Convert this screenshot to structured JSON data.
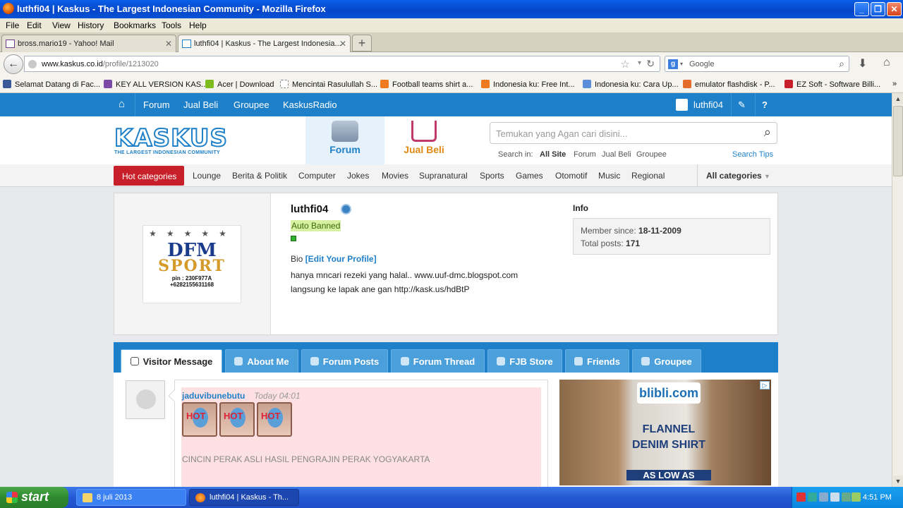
{
  "window": {
    "title": "luthfi04 | Kaskus - The Largest Indonesian Community - Mozilla Firefox"
  },
  "menu": [
    "File",
    "Edit",
    "View",
    "History",
    "Bookmarks",
    "Tools",
    "Help"
  ],
  "tabs": [
    {
      "label": "bross.mario19 - Yahoo! Mail",
      "active": false
    },
    {
      "label": "luthfi04 | Kaskus - The Largest Indonesia...",
      "active": true
    }
  ],
  "address": {
    "host": "www.kaskus.co.id",
    "path": "/profile/1213020"
  },
  "browser_search": {
    "engine_icon": "google-icon",
    "placeholder": "Google"
  },
  "bookmarks": [
    "Selamat Datang di Fac...",
    "KEY ALL VERSION KAS...",
    "Acer | Download",
    "Mencintai Rasulullah S...",
    "Football teams shirt a...",
    "Indonesia ku: Free Int...",
    "Indonesia ku: Cara Up...",
    "emulator flashdisk - P...",
    "EZ Soft - Software Billi..."
  ],
  "kaskus_nav": {
    "links": [
      "Forum",
      "Jual Beli",
      "Groupee",
      "KaskusRadio"
    ],
    "user": "luthfi04"
  },
  "header": {
    "logo": "KASKUS",
    "logo_sub": "THE LARGEST INDONESIAN COMMUNITY",
    "forum_label": "Forum",
    "jualbeli_label": "Jual Beli",
    "search_placeholder": "Temukan yang Agan cari disini...",
    "search_in_label": "Search in:",
    "search_in_options": [
      "All Site",
      "Forum",
      "Jual Beli",
      "Groupee"
    ],
    "search_tips": "Search Tips"
  },
  "categories": {
    "hot": "Hot categories",
    "items": [
      "Lounge",
      "Berita & Politik",
      "Computer",
      "Jokes",
      "Movies",
      "Supranatural",
      "Sports",
      "Games",
      "Otomotif",
      "Music",
      "Regional"
    ],
    "all": "All categories"
  },
  "profile": {
    "avatar_text": {
      "line1": "DFM",
      "line2": "SPORT",
      "pin": "pin : 230F977A",
      "phone": "+6282155631168"
    },
    "username": "luthfi04",
    "status": "Auto Banned",
    "bio_label": "Bio",
    "edit_link": "[Edit Your Profile]",
    "bio_line1": "hanya mncari rezeki yang halal.. www.uuf-dmc.blogspot.com",
    "bio_line2": "langsung ke lapak ane gan http://kask.us/hdBtP",
    "info_title": "Info",
    "member_since_label": "Member since:",
    "member_since": "18-11-2009",
    "total_posts_label": "Total posts:",
    "total_posts": "171"
  },
  "profile_tabs": [
    "Visitor Message",
    "About Me",
    "Forum Posts",
    "Forum Thread",
    "FJB Store",
    "Friends",
    "Groupee"
  ],
  "visitor_message": {
    "author": "jaduvibunebutu",
    "time": "Today 04:01",
    "badge_text": "HOT",
    "text": "CINCIN PERAK ASLI HASIL PENGRAJIN PERAK YOGYAKARTA"
  },
  "ad": {
    "brand": "blibli.com",
    "line1": "FLANNEL",
    "line2": "DENIM SHIRT",
    "line3": "AS LOW AS"
  },
  "taskbar": {
    "start": "start",
    "items": [
      "8 juli 2013",
      "luthfi04 | Kaskus - Th..."
    ],
    "clock": "4:51 PM"
  }
}
